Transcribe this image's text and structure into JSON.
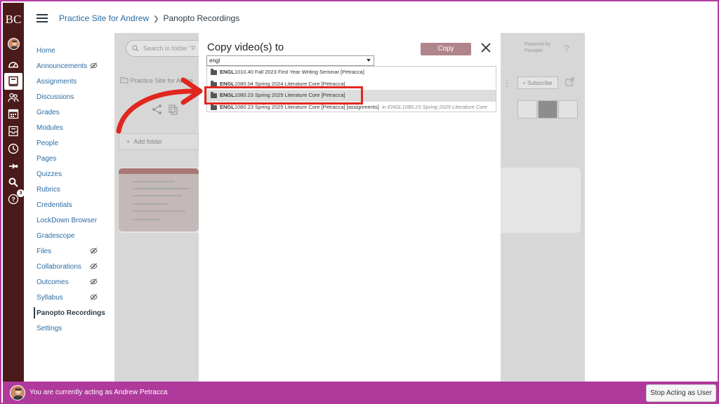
{
  "app": {
    "logo": "BC",
    "badge_count": "3"
  },
  "breadcrumb": {
    "course": "Practice Site for Andrew",
    "page": "Panopto Recordings"
  },
  "course_nav": [
    {
      "label": "Home",
      "hidden": false
    },
    {
      "label": "Announcements",
      "hidden": true
    },
    {
      "label": "Assignments",
      "hidden": false
    },
    {
      "label": "Discussions",
      "hidden": false
    },
    {
      "label": "Grades",
      "hidden": false
    },
    {
      "label": "Modules",
      "hidden": false
    },
    {
      "label": "People",
      "hidden": false
    },
    {
      "label": "Pages",
      "hidden": false
    },
    {
      "label": "Quizzes",
      "hidden": false
    },
    {
      "label": "Rubrics",
      "hidden": false
    },
    {
      "label": "Credentials",
      "hidden": false
    },
    {
      "label": "LockDown Browser",
      "hidden": false
    },
    {
      "label": "Gradescope",
      "hidden": false
    },
    {
      "label": "Files",
      "hidden": true
    },
    {
      "label": "Collaborations",
      "hidden": true
    },
    {
      "label": "Outcomes",
      "hidden": true
    },
    {
      "label": "Syllabus",
      "hidden": true
    },
    {
      "label": "Panopto Recordings",
      "hidden": false,
      "active": true
    },
    {
      "label": "Settings",
      "hidden": false
    }
  ],
  "panopto": {
    "search_placeholder": "Search in folder \"P",
    "folder_label": "Practice Site for Andre",
    "powered_by": "Powered by Panopto",
    "help": "?",
    "subscribe": "Subscribe",
    "add_folder": "Add folder"
  },
  "modal": {
    "title": "Copy video(s) to",
    "copy_label": "Copy",
    "search_value": "engl",
    "options": [
      {
        "code": "ENGL",
        "rest": "1010.40 Fall 2023 First Year Writing Seminar [Petracca]",
        "location": ""
      },
      {
        "code": "ENGL",
        "rest": "1080.04 Spring 2024 Literature Core [Petracca]",
        "location": ""
      },
      {
        "code": "ENGL",
        "rest": "1080.23 Spring 2025 Literature Core [Petracca]",
        "location": "",
        "selected": true
      },
      {
        "code": "ENGL",
        "rest": "1080.23 Spring 2025 Literature Core [Petracca] [assignments]",
        "location": "in ENGL1080.23 Spring 2025 Literature Core"
      }
    ]
  },
  "acting_bar": {
    "message": "You are currently acting as Andrew Petracca",
    "stop_label": "Stop Acting as User"
  },
  "colors": {
    "brand": "#4b1a1a",
    "acting": "#b0399c",
    "highlight": "#e0271f",
    "link": "#2b6ca3"
  }
}
